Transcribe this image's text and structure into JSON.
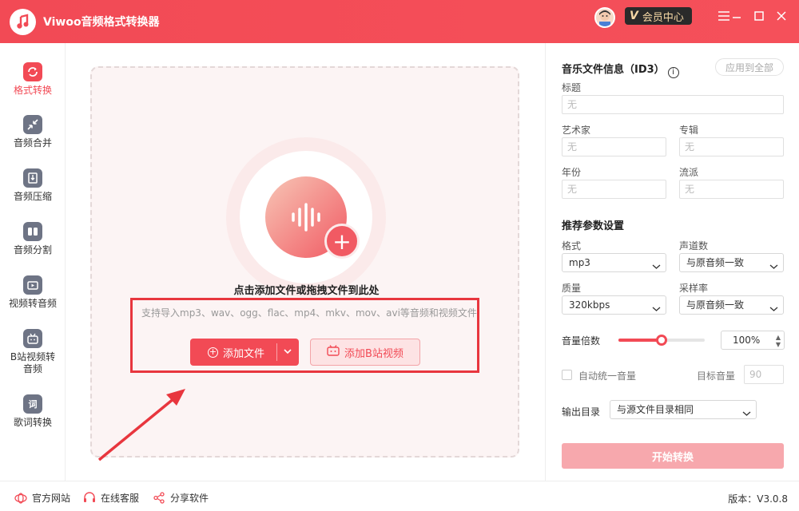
{
  "app": {
    "title": "Viwoo音频格式转换器",
    "vip_badge": "会员中心",
    "vip_letter": "V"
  },
  "sidebar": {
    "items": [
      {
        "label": "格式转换",
        "icon": "format-convert-icon",
        "active": true
      },
      {
        "label": "音频合并",
        "icon": "audio-merge-icon",
        "active": false
      },
      {
        "label": "音频压缩",
        "icon": "audio-compress-icon",
        "active": false
      },
      {
        "label": "音频分割",
        "icon": "audio-split-icon",
        "active": false
      },
      {
        "label": "视频转音频",
        "icon": "video-to-audio-icon",
        "active": false
      },
      {
        "label": "B站视频转音频",
        "icon": "bilibili-icon",
        "active": false
      },
      {
        "label": "歌词转换",
        "icon": "lyrics-icon",
        "active": false
      }
    ]
  },
  "dropzone": {
    "title": "点击添加文件或拖拽文件到此处",
    "hint": "支持导入mp3、wav、ogg、flac、mp4、mkv、mov、avi等音频和视频文件",
    "add_file_label": "添加文件",
    "add_bilibili_label": "添加B站视频"
  },
  "panel": {
    "id3_title": "音乐文件信息（ID3）",
    "apply_all": "应用到全部",
    "fields": {
      "title": {
        "label": "标题",
        "placeholder": "无"
      },
      "artist": {
        "label": "艺术家",
        "placeholder": "无"
      },
      "album": {
        "label": "专辑",
        "placeholder": "无"
      },
      "year": {
        "label": "年份",
        "placeholder": "无"
      },
      "genre": {
        "label": "流派",
        "placeholder": "无"
      }
    },
    "params_title": "推荐参数设置",
    "format": {
      "label": "格式",
      "value": "mp3"
    },
    "channels": {
      "label": "声道数",
      "value": "与原音频一致"
    },
    "quality": {
      "label": "质量",
      "value": "320kbps"
    },
    "samplerate": {
      "label": "采样率",
      "value": "与原音频一致"
    },
    "volume": {
      "label": "音量倍数",
      "value": "100%",
      "level": 0.5
    },
    "auto_volume": {
      "label": "自动统一音量",
      "checked": false
    },
    "target_volume": {
      "label": "目标音量",
      "value": "90"
    },
    "output": {
      "label": "输出目录",
      "value": "与源文件目录相同"
    },
    "start_button": "开始转换"
  },
  "footer": {
    "website": "官方网站",
    "support": "在线客服",
    "share": "分享软件",
    "version": "版本：V3.0.8"
  },
  "colors": {
    "accent": "#f24a55",
    "start_disabled": "#f7a8ad",
    "annotation_red": "#e8363e"
  }
}
